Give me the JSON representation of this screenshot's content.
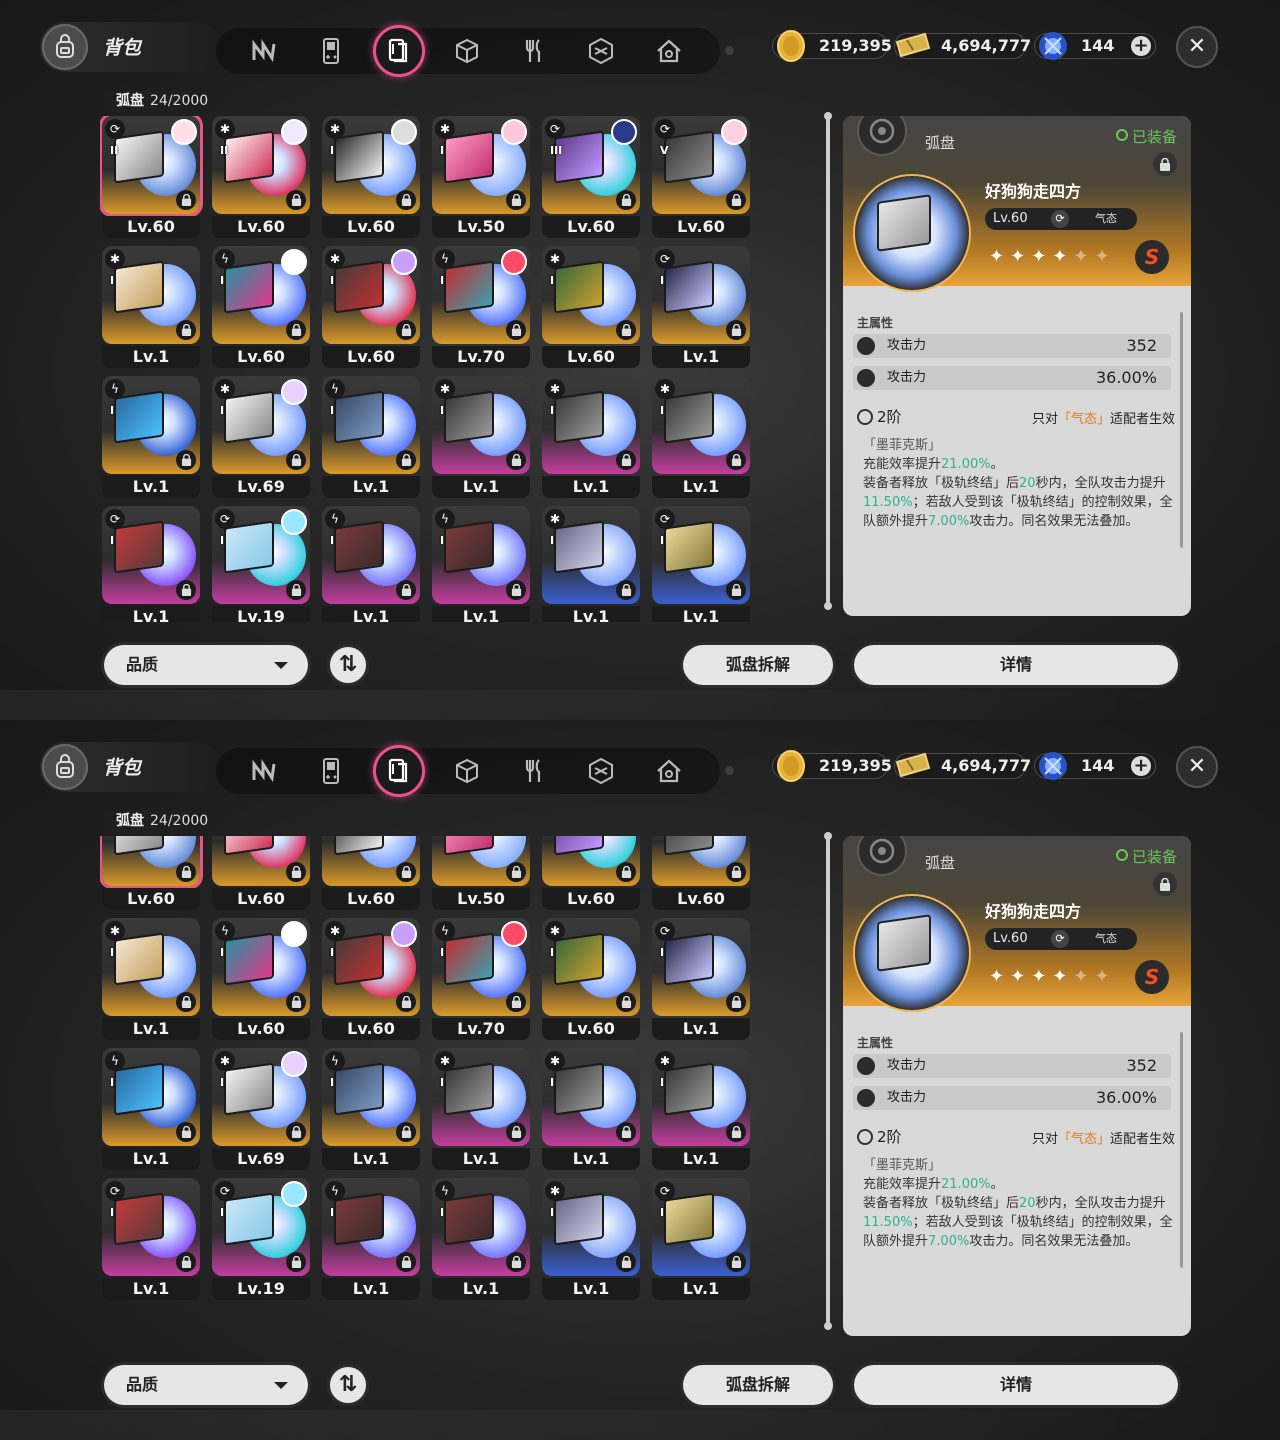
{
  "header": {
    "title": "背包",
    "tabs": [
      {
        "icon": "zigzag-icon",
        "active": false
      },
      {
        "icon": "gameboy-icon",
        "active": false
      },
      {
        "icon": "disc-icon",
        "active": true
      },
      {
        "icon": "cube-icon",
        "active": false
      },
      {
        "icon": "fork-knife-icon",
        "active": false
      },
      {
        "icon": "hexagon-icon",
        "active": false
      },
      {
        "icon": "house-icon",
        "active": false
      }
    ],
    "currencies": [
      {
        "icon": "gold-coin-icon",
        "value": "219,395"
      },
      {
        "icon": "ticket-icon",
        "value": "4,694,777"
      },
      {
        "icon": "blue-gem-icon",
        "value": "144",
        "has_plus": true
      }
    ],
    "close_label": "✕"
  },
  "inventory": {
    "category": "弧盘",
    "count": "24/2000",
    "items": [
      {
        "level": "Lv.60",
        "rank": "II",
        "attr": "⟳",
        "avatar": true,
        "bottom": "#d99a2b",
        "selected": true
      },
      {
        "level": "Lv.60",
        "rank": "II",
        "attr": "✱",
        "avatar": true,
        "bottom": "#d99a2b"
      },
      {
        "level": "Lv.60",
        "rank": "I",
        "attr": "✱",
        "avatar": true,
        "bottom": "#d99a2b"
      },
      {
        "level": "Lv.50",
        "rank": "I",
        "attr": "✱",
        "avatar": true,
        "bottom": "#d99a2b"
      },
      {
        "level": "Lv.60",
        "rank": "III",
        "attr": "⟳",
        "avatar": true,
        "bottom": "#d99a2b"
      },
      {
        "level": "Lv.60",
        "rank": "V",
        "attr": "⟳",
        "avatar": true,
        "bottom": "#d99a2b"
      },
      {
        "level": "Lv.1",
        "rank": "I",
        "attr": "✱",
        "avatar": false,
        "bottom": "#d99a2b"
      },
      {
        "level": "Lv.60",
        "rank": "I",
        "attr": "ϟ",
        "avatar": true,
        "bottom": "#d99a2b"
      },
      {
        "level": "Lv.60",
        "rank": "I",
        "attr": "✱",
        "avatar": true,
        "bottom": "#d99a2b"
      },
      {
        "level": "Lv.70",
        "rank": "I",
        "attr": "ϟ",
        "avatar": true,
        "bottom": "#d99a2b"
      },
      {
        "level": "Lv.60",
        "rank": "I",
        "attr": "✱",
        "avatar": false,
        "bottom": "#d99a2b"
      },
      {
        "level": "Lv.1",
        "rank": "I",
        "attr": "⟳",
        "avatar": false,
        "bottom": "#d99a2b"
      },
      {
        "level": "Lv.1",
        "rank": "I",
        "attr": "ϟ",
        "avatar": false,
        "bottom": "#d99a2b"
      },
      {
        "level": "Lv.69",
        "rank": "I",
        "attr": "✱",
        "avatar": true,
        "bottom": "#d99a2b"
      },
      {
        "level": "Lv.1",
        "rank": "I",
        "attr": "ϟ",
        "avatar": false,
        "bottom": "#d99a2b"
      },
      {
        "level": "Lv.1",
        "rank": "I",
        "attr": "✱",
        "avatar": false,
        "bottom": "#c43ea0"
      },
      {
        "level": "Lv.1",
        "rank": "I",
        "attr": "✱",
        "avatar": false,
        "bottom": "#c43ea0"
      },
      {
        "level": "Lv.1",
        "rank": "I",
        "attr": "✱",
        "avatar": false,
        "bottom": "#c43ea0"
      },
      {
        "level": "Lv.1",
        "rank": "I",
        "attr": "⟳",
        "avatar": false,
        "bottom": "#c43ea0"
      },
      {
        "level": "Lv.19",
        "rank": "I",
        "attr": "⟳",
        "avatar": true,
        "bottom": "#c43ea0"
      },
      {
        "level": "Lv.1",
        "rank": "I",
        "attr": "ϟ",
        "avatar": false,
        "bottom": "#c43ea0"
      },
      {
        "level": "Lv.1",
        "rank": "I",
        "attr": "ϟ",
        "avatar": false,
        "bottom": "#c43ea0"
      },
      {
        "level": "Lv.1",
        "rank": "I",
        "attr": "✱",
        "avatar": false,
        "bottom": "#3a5fd0"
      },
      {
        "level": "Lv.1",
        "rank": "I",
        "attr": "⟳",
        "avatar": false,
        "bottom": "#3a5fd0"
      }
    ]
  },
  "detail": {
    "type": "弧盘",
    "equipped": "已装备",
    "name": "好狗狗走四方",
    "level": "Lv.60",
    "attribute": "气态",
    "stars_filled": 4,
    "stars_total": 6,
    "rank": "S",
    "main_label": "主属性",
    "stats": [
      {
        "name": "攻击力",
        "value": "352"
      },
      {
        "name": "攻击力",
        "value": "36.00%"
      }
    ],
    "tier": "2阶",
    "condition_prefix": "只对",
    "condition_attr": "「气态」",
    "condition_suffix": "适配者生效",
    "effect_name": "「墨菲克斯」",
    "effect_line1_a": "充能效率提升",
    "effect_line1_b": "21.00%",
    "effect_line1_c": "。",
    "effect_line2_a": "装备者释放「极轨终结」后",
    "effect_line2_b": "20",
    "effect_line2_c": "秒内，全队攻击力提升",
    "effect_line2_d": "11.50%",
    "effect_line2_e": "；若敌人受到该「极轨终结」的控制效果，全队额外提升",
    "effect_line2_f": "7.00%",
    "effect_line2_g": "攻击力。同名效果无法叠加。"
  },
  "footer": {
    "filter_label": "品质",
    "sort_label": "⇅",
    "dismantle_label": "弧盘拆解",
    "details_label": "详情"
  },
  "colors": {
    "accent": "#e8548a",
    "gold": "#d99a2b",
    "purple": "#c43ea0",
    "blue": "#3a5fd0",
    "green": "#2fb28a",
    "orange": "#e07a1a"
  }
}
